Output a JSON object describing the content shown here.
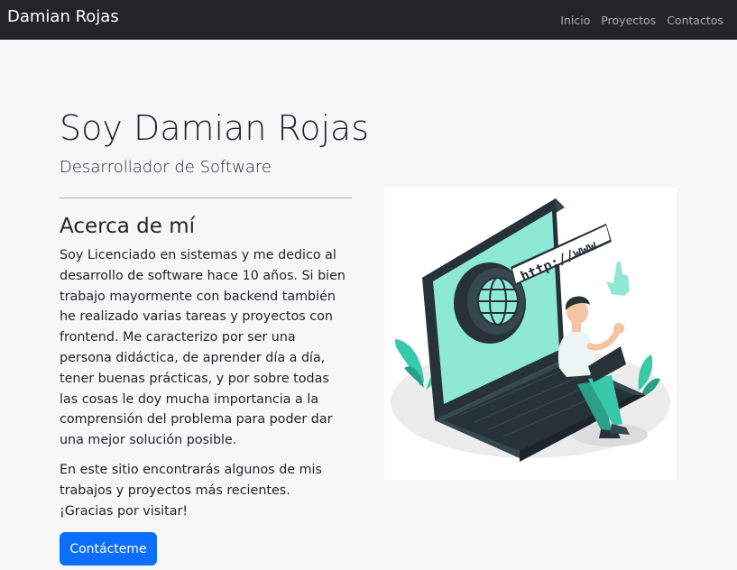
{
  "navbar": {
    "brand": "Damian Rojas",
    "links": [
      "Inicio",
      "Proyectos",
      "Contactos"
    ]
  },
  "hero": {
    "title": "Soy Damian Rojas",
    "subtitle": "Desarrollador de Software"
  },
  "about": {
    "heading": "Acerca de mí",
    "paragraph1": "Soy Licenciado en sistemas y me dedico al desarrollo de software hace 10 años. Si bien trabajo mayormente con backend también he realizado varias tareas y proyectos con frontend. Me caracterizo por ser una persona didáctica, de aprender día a día, tener buenas prácticas, y por sobre todas las cosas le doy mucha importancia a la comprensión del problema para poder dar una mejor solución posible.",
    "paragraph2": "En este sitio encontrarás algunos de mis trabajos y proyectos más recientes. ¡Gracias por visitar!",
    "contact_button": "Contácteme"
  },
  "illustration": {
    "url_text": "http://www."
  },
  "colors": {
    "navbar_bg": "#212529",
    "primary": "#0d6efd",
    "accent": "#5fe0c8",
    "dark_device": "#263238"
  }
}
